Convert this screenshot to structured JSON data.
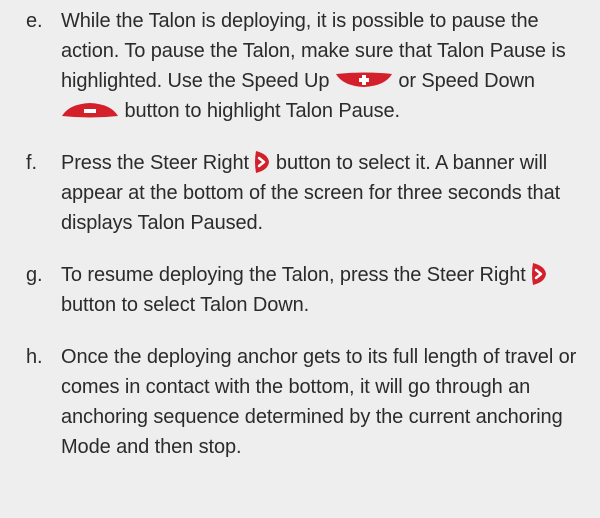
{
  "steps": [
    {
      "letter": "e.",
      "segments": [
        "While the Talon is deploying, it is possible to pause the action. To pause the Talon, make sure that Talon Pause is highlighted. Use the Speed Up ",
        " or Speed Down ",
        " button to highlight Talon Pause."
      ],
      "icons": [
        "speed-up-icon",
        "speed-down-icon"
      ]
    },
    {
      "letter": "f.",
      "segments": [
        "Press the Steer Right ",
        " button to select it. A banner will appear at the bottom of the screen for three seconds that displays Talon Paused."
      ],
      "icons": [
        "steer-right-icon"
      ]
    },
    {
      "letter": "g.",
      "segments": [
        "To resume deploying the Talon, press the Steer Right ",
        " button to select Talon Down."
      ],
      "icons": [
        "steer-right-icon"
      ]
    },
    {
      "letter": "h.",
      "segments": [
        "Once the deploying anchor gets to its full length of travel or comes in contact with the bottom, it will go through an anchoring sequence determined by the current anchoring Mode and then stop."
      ],
      "icons": []
    }
  ],
  "colors": {
    "background": "#eeeeee",
    "text": "#2b2b2b",
    "button_red": "#d3202b",
    "button_symbol": "#ffffff"
  }
}
